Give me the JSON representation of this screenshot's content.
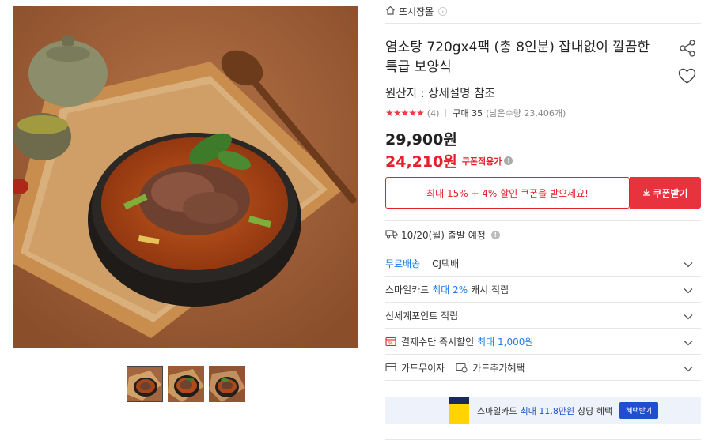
{
  "store": {
    "name": "또시장몰",
    "icon": "home-icon"
  },
  "product": {
    "title": "염소탕 720gx4팩 (총 8인분) 잡내없이 깔끔한 특급 보양식",
    "origin": "원산지 : 상세설명 참조",
    "rating": {
      "stars": 5,
      "stars_text": "★★★★★",
      "count": "(4)"
    },
    "purchase": "구매 35",
    "remaining": "(남은수량 23,406개)",
    "price_original": "29,900원",
    "price_sale": "24,210원",
    "coupon_label": "쿠폰적용가",
    "info_symbol": "!"
  },
  "coupon": {
    "message": "최대 15% + 4% 할인 쿠폰을 받으세요!",
    "button": "쿠폰받기"
  },
  "shipping": {
    "date": "10/20(월) 출발 예정"
  },
  "rows": [
    {
      "prefix": "무료배송",
      "text": "CJ택배"
    },
    {
      "a": "스마일카드 ",
      "b": "최대 2%",
      "c": " 캐시 적립"
    },
    {
      "text": "신세계포인트 적립"
    },
    {
      "a": "결제수단 즉시할인 ",
      "b": "최대 1,000원"
    },
    {
      "left": "카드무이자",
      "right": "카드추가혜택"
    }
  ],
  "banner": {
    "text": "스마일카드",
    "highlight": "최대 11.8만원",
    "text2": "상당 혜택",
    "button": "혜택받기"
  },
  "colors": {
    "accent": "#e5202c",
    "blue": "#1e7ce8",
    "banner_bg": "#eef3fb"
  }
}
